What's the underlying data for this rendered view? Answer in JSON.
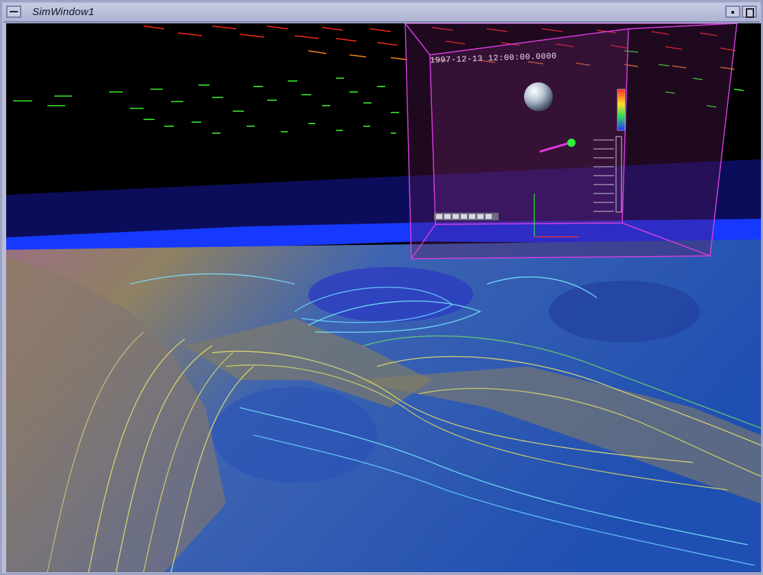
{
  "window": {
    "title": "SimWindow1"
  },
  "scene": {
    "timestamp": "1997-12-13 12:00:00.0000",
    "colors": {
      "upper_vectors_warm": "#ff2a1a",
      "upper_vectors_cool": "#3cf32a",
      "water_blue": "#1e3cff",
      "field_tan": "#8d8162",
      "field_blue": "#2c5bb8",
      "probe_box": "#d63ee0"
    }
  }
}
